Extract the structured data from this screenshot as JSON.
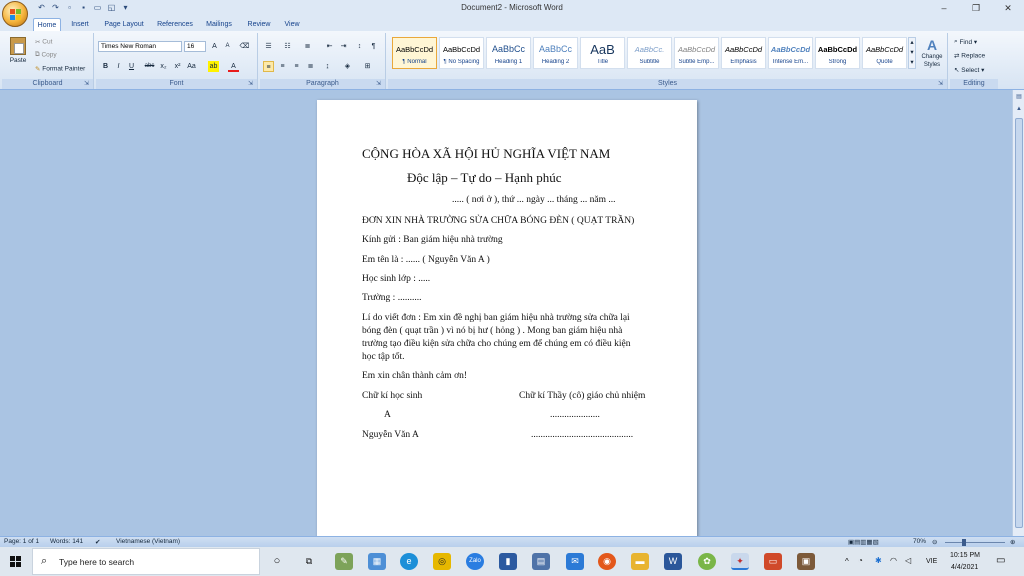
{
  "window": {
    "title": "Document2 - Microsoft Word",
    "controls": [
      "–",
      "❐",
      "✕"
    ]
  },
  "tabs": [
    "Home",
    "Insert",
    "Page Layout",
    "References",
    "Mailings",
    "Review",
    "View"
  ],
  "ribbon": {
    "clipboard": {
      "paste": "Paste",
      "cut": "Cut",
      "copy": "Copy",
      "format_painter": "Format Painter",
      "label": "Clipboard"
    },
    "font": {
      "name": "Times New Roman",
      "size": "16",
      "label": "Font"
    },
    "paragraph": {
      "label": "Paragraph"
    },
    "styles": {
      "label": "Styles",
      "items": [
        {
          "preview": "AaBbCcDd",
          "label": "¶ Normal"
        },
        {
          "preview": "AaBbCcDd",
          "label": "¶ No Spacing"
        },
        {
          "preview": "AaBbCc",
          "label": "Heading 1"
        },
        {
          "preview": "AaBbCc",
          "label": "Heading 2"
        },
        {
          "preview": "AaB",
          "label": "Title"
        },
        {
          "preview": "AaBbCc.",
          "label": "Subtitle"
        },
        {
          "preview": "AaBbCcDd",
          "label": "Subtle Emp..."
        },
        {
          "preview": "AaBbCcDd",
          "label": "Emphasis"
        },
        {
          "preview": "AaBbCcDd",
          "label": "Intense Em..."
        },
        {
          "preview": "AaBbCcDd",
          "label": "Strong"
        },
        {
          "preview": "AaBbCcDd",
          "label": "Quote"
        }
      ],
      "change_styles": "Change Styles"
    },
    "editing": {
      "find": "Find",
      "replace": "Replace",
      "select": "Select",
      "label": "Editing"
    }
  },
  "document": {
    "line1": "CỘNG HÒA XÃ HỘI HỦ NGHĨA VIỆT NAM",
    "line2": "Độc lập – Tự do – Hạnh phúc",
    "date_line": "..... ( nơi ở ), thứ ... ngày ... tháng ... năm ...",
    "heading": "ĐƠN XIN NHÀ TRƯỜNG SỬA CHỮA BÓNG ĐÈN ( QUẠT TRẦN)",
    "to": "Kính gửi : Ban giám hiệu nhà trường",
    "name": "Em tên là : ...... ( Nguyễn Văn A )",
    "class": "Học sinh lớp : .....",
    "school": "Trường : ..........",
    "reason_1": "Lí do viết đơn : Em xin đề nghị ban giám hiệu nhà trường sửa chữa lại",
    "reason_2": "bóng đèn ( quạt trần ) vì nó bị hư ( hỏng ) . Mong ban giám hiệu nhà",
    "reason_3": "trường tạo điều kiện sửa chữa cho chúng em để chúng em có điều kiện",
    "reason_4": "học tập tốt.",
    "thanks": "Em xin chân thành cảm ơn!",
    "sig_student": "Chữ kí học sinh",
    "sig_teacher": "Chữ kí Thầy (cô) giáo chủ nhiệm",
    "sig_a": "A",
    "sig_dots_1": ".....................",
    "sig_name": "Nguyễn Văn A",
    "sig_dots_2": "..........................................."
  },
  "status": {
    "page": "Page: 1 of 1",
    "words": "Words: 141",
    "language": "Vietnamese (Vietnam)",
    "zoom": "70%"
  },
  "taskbar": {
    "search_placeholder": "Type here to search",
    "time": "10:15 PM",
    "date": "4/4/2021",
    "lang": "VIE"
  },
  "colors": {
    "ribbon_accent": "#15428b",
    "workspace": "#aac4e3",
    "selected_style": "#e9a83b"
  }
}
